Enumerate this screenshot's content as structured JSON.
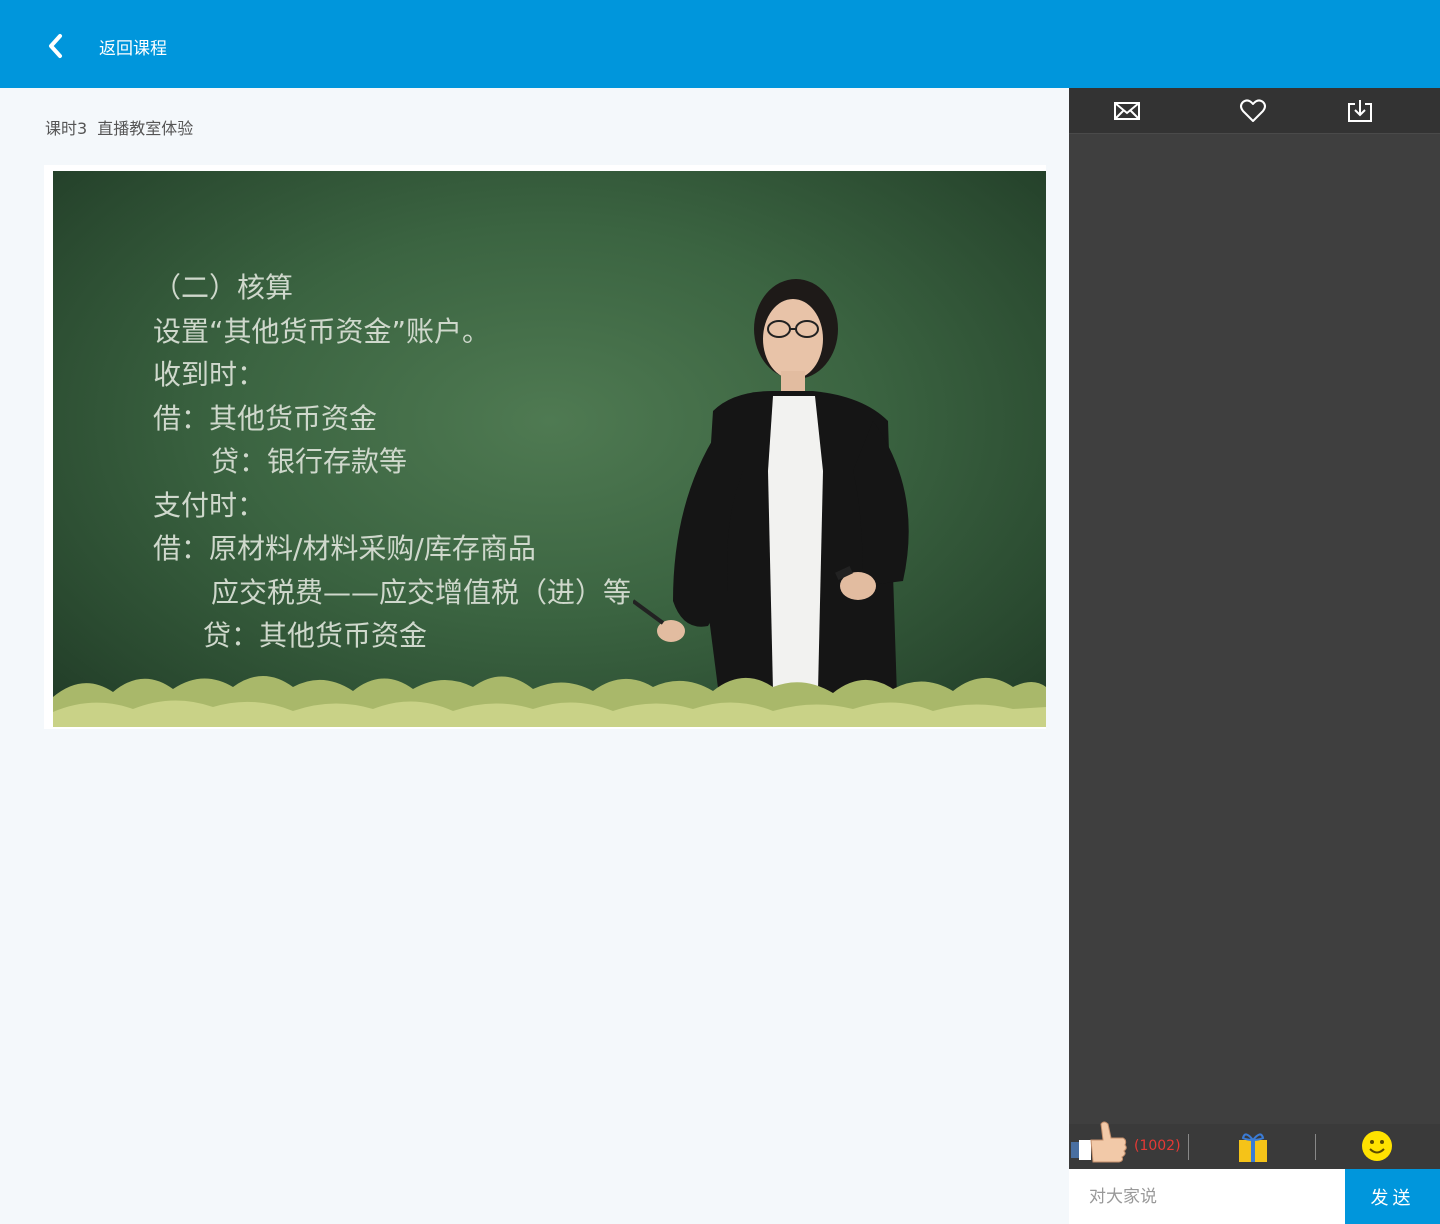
{
  "header": {
    "back_label": "返回课程"
  },
  "lesson": {
    "number": "课时3",
    "title": "直播教室体验"
  },
  "video": {
    "board_lines": [
      "（二）核算",
      "设置“其他货币资金”账户。",
      "收到时：",
      "借：其他货币资金",
      "贷：银行存款等",
      "支付时：",
      "借：原材料/材料采购/库存商品",
      "应交税费——应交增值税（进）等",
      "贷：其他货币资金"
    ]
  },
  "sidebar": {
    "tools": [
      "mail-icon",
      "heart-icon",
      "download-icon"
    ],
    "like_count": "(1002)",
    "chat_placeholder": "对大家说",
    "send_label": "发送"
  }
}
